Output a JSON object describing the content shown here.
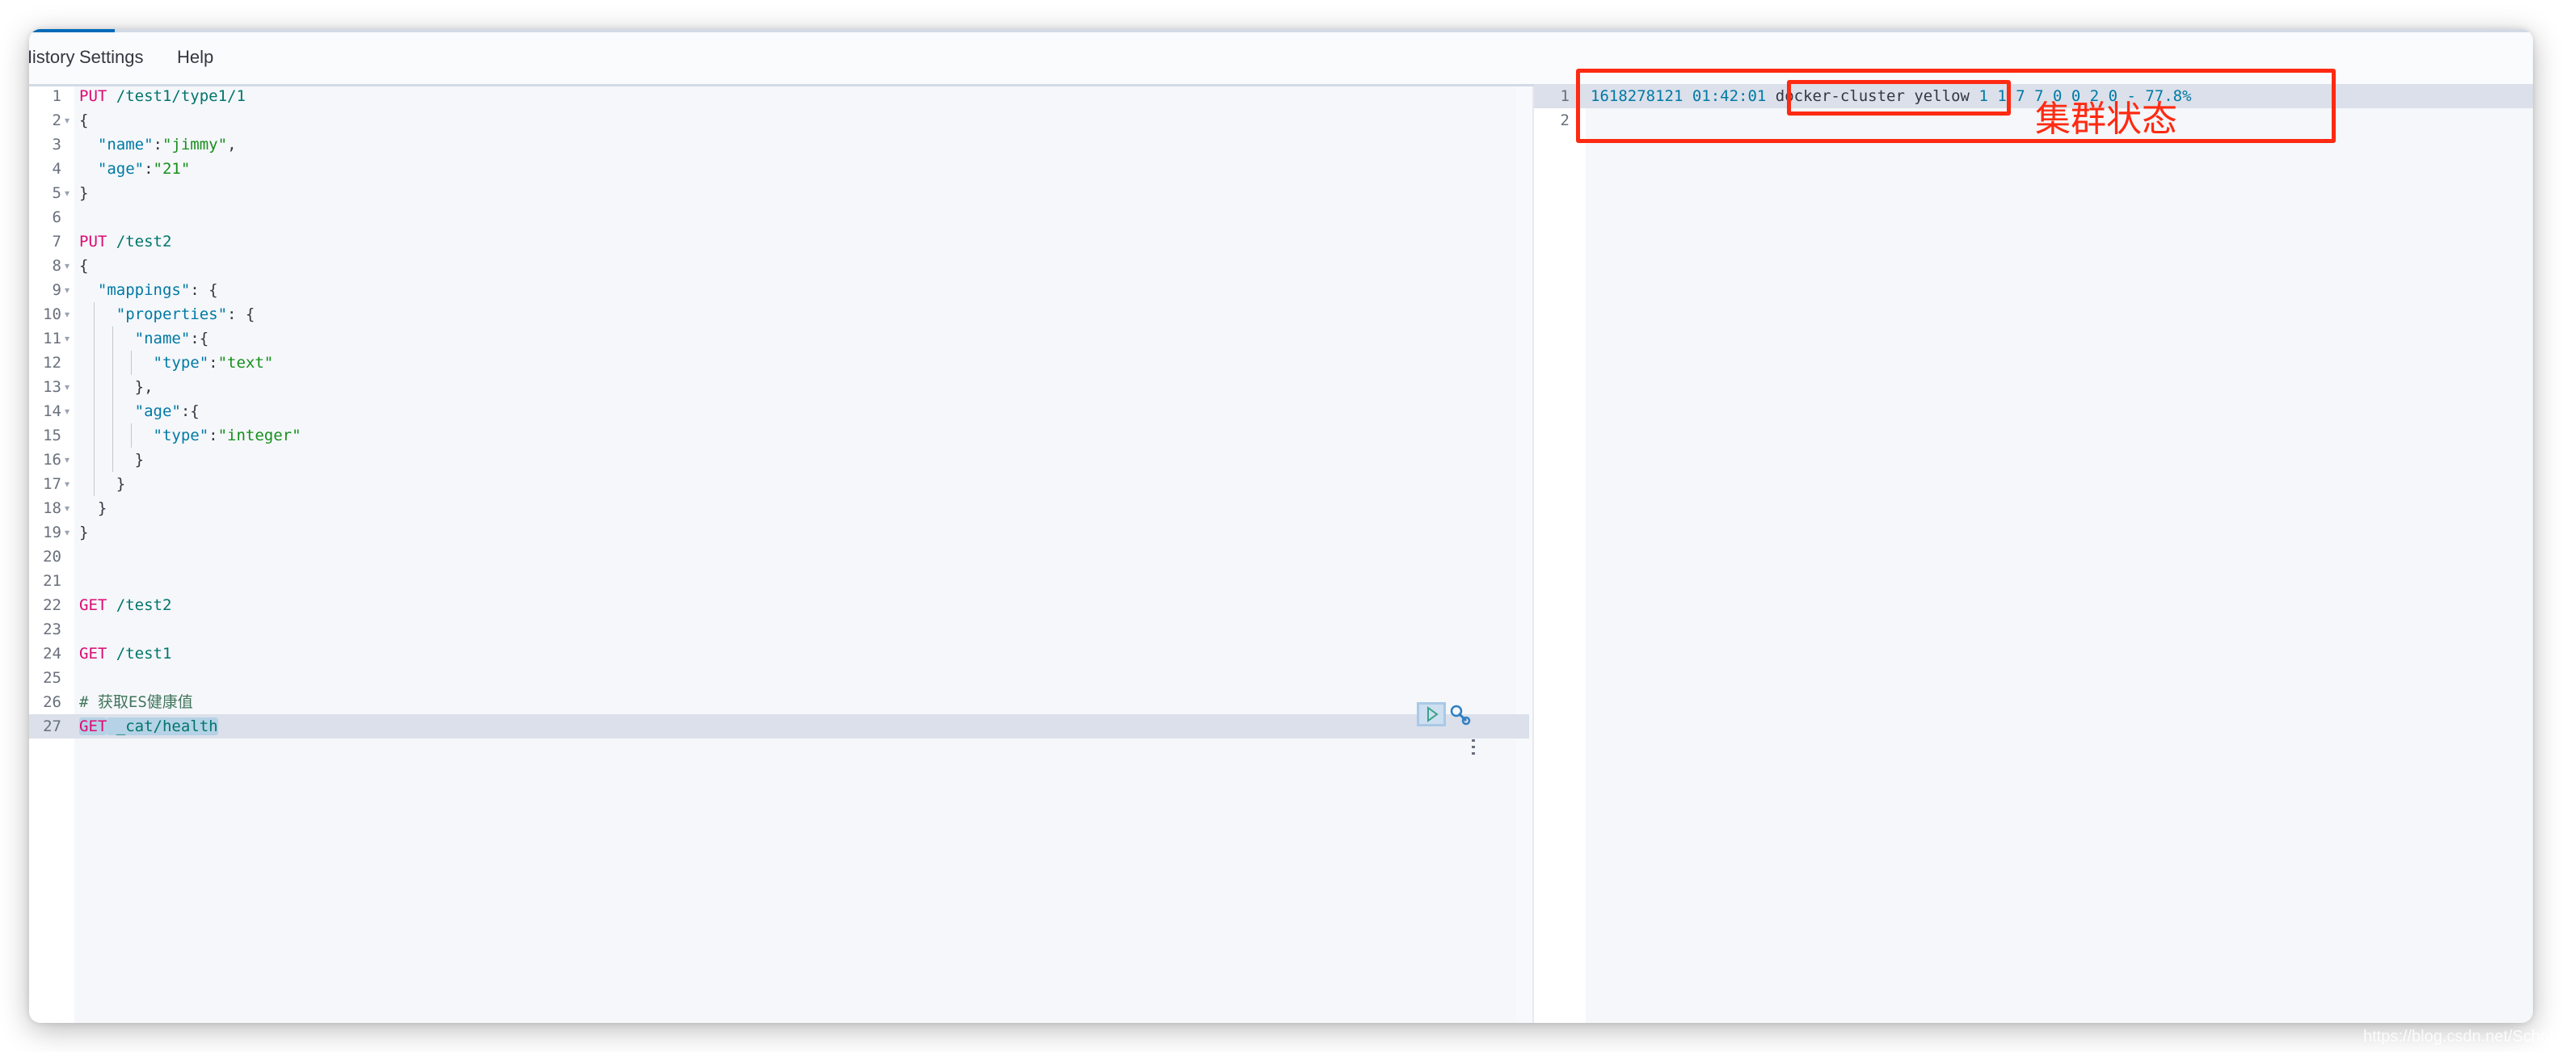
{
  "menu": {
    "items": [
      "History",
      "Settings",
      "Help"
    ]
  },
  "request_editor": {
    "lines": [
      {
        "n": "1",
        "fold": false,
        "tokens": [
          {
            "t": "PUT",
            "c": "m"
          },
          {
            "t": " /test1/type1/1",
            "c": "u"
          }
        ]
      },
      {
        "n": "2",
        "fold": true,
        "tokens": [
          {
            "t": "{",
            "c": "p"
          }
        ]
      },
      {
        "n": "3",
        "fold": false,
        "tokens": [
          {
            "t": "  ",
            "c": "p"
          },
          {
            "t": "\"name\"",
            "c": "k"
          },
          {
            "t": ":",
            "c": "p"
          },
          {
            "t": "\"jimmy\"",
            "c": "s"
          },
          {
            "t": ",",
            "c": "p"
          }
        ]
      },
      {
        "n": "4",
        "fold": false,
        "tokens": [
          {
            "t": "  ",
            "c": "p"
          },
          {
            "t": "\"age\"",
            "c": "k"
          },
          {
            "t": ":",
            "c": "p"
          },
          {
            "t": "\"21\"",
            "c": "s"
          }
        ]
      },
      {
        "n": "5",
        "fold": true,
        "tokens": [
          {
            "t": "}",
            "c": "p"
          }
        ]
      },
      {
        "n": "6",
        "fold": false,
        "tokens": []
      },
      {
        "n": "7",
        "fold": false,
        "tokens": [
          {
            "t": "PUT",
            "c": "m"
          },
          {
            "t": " /test2",
            "c": "u"
          }
        ]
      },
      {
        "n": "8",
        "fold": true,
        "tokens": [
          {
            "t": "{",
            "c": "p"
          }
        ]
      },
      {
        "n": "9",
        "fold": true,
        "tokens": [
          {
            "t": "  ",
            "c": "p"
          },
          {
            "t": "\"mappings\"",
            "c": "k"
          },
          {
            "t": ": {",
            "c": "p"
          }
        ]
      },
      {
        "n": "10",
        "fold": true,
        "guides": 1,
        "tokens": [
          {
            "t": "    ",
            "c": "p"
          },
          {
            "t": "\"properties\"",
            "c": "k"
          },
          {
            "t": ": {",
            "c": "p"
          }
        ]
      },
      {
        "n": "11",
        "fold": true,
        "guides": 2,
        "tokens": [
          {
            "t": "      ",
            "c": "p"
          },
          {
            "t": "\"name\"",
            "c": "k"
          },
          {
            "t": ":{",
            "c": "p"
          }
        ]
      },
      {
        "n": "12",
        "fold": false,
        "guides": 3,
        "tokens": [
          {
            "t": "        ",
            "c": "p"
          },
          {
            "t": "\"type\"",
            "c": "k"
          },
          {
            "t": ":",
            "c": "p"
          },
          {
            "t": "\"text\"",
            "c": "s"
          }
        ]
      },
      {
        "n": "13",
        "fold": true,
        "guides": 2,
        "tokens": [
          {
            "t": "      },",
            "c": "p"
          }
        ]
      },
      {
        "n": "14",
        "fold": true,
        "guides": 2,
        "tokens": [
          {
            "t": "      ",
            "c": "p"
          },
          {
            "t": "\"age\"",
            "c": "k"
          },
          {
            "t": ":{",
            "c": "p"
          }
        ]
      },
      {
        "n": "15",
        "fold": false,
        "guides": 3,
        "tokens": [
          {
            "t": "        ",
            "c": "p"
          },
          {
            "t": "\"type\"",
            "c": "k"
          },
          {
            "t": ":",
            "c": "p"
          },
          {
            "t": "\"integer\"",
            "c": "s"
          }
        ]
      },
      {
        "n": "16",
        "fold": true,
        "guides": 2,
        "tokens": [
          {
            "t": "      }",
            "c": "p"
          }
        ]
      },
      {
        "n": "17",
        "fold": true,
        "guides": 1,
        "tokens": [
          {
            "t": "    }",
            "c": "p"
          }
        ]
      },
      {
        "n": "18",
        "fold": true,
        "tokens": [
          {
            "t": "  }",
            "c": "p"
          }
        ]
      },
      {
        "n": "19",
        "fold": true,
        "tokens": [
          {
            "t": "}",
            "c": "p"
          }
        ]
      },
      {
        "n": "20",
        "fold": false,
        "tokens": []
      },
      {
        "n": "21",
        "fold": false,
        "tokens": []
      },
      {
        "n": "22",
        "fold": false,
        "tokens": [
          {
            "t": "GET",
            "c": "m"
          },
          {
            "t": " /test2",
            "c": "u"
          }
        ]
      },
      {
        "n": "23",
        "fold": false,
        "tokens": []
      },
      {
        "n": "24",
        "fold": false,
        "tokens": [
          {
            "t": "GET",
            "c": "m"
          },
          {
            "t": " /test1",
            "c": "u"
          }
        ]
      },
      {
        "n": "25",
        "fold": false,
        "tokens": []
      },
      {
        "n": "26",
        "fold": false,
        "tokens": [
          {
            "t": "# 获取ES健康值",
            "c": "c"
          }
        ]
      },
      {
        "n": "27",
        "fold": false,
        "active": true,
        "tokens": [
          {
            "t": "GET",
            "c": "m",
            "sel": true
          },
          {
            "t": " _cat/health",
            "c": "u",
            "sel": true
          }
        ]
      }
    ],
    "actions": {
      "run_icon": "play-icon",
      "settings_icon": "wrench-icon"
    }
  },
  "response_editor": {
    "lines": [
      {
        "n": "1",
        "active": true,
        "tokens": [
          {
            "t": "1618278121 01:42:01 ",
            "c": "n"
          },
          {
            "t": "docker-cluster yellow",
            "c": "p"
          },
          {
            "t": " 1 1 7 7 0 0 2 0 - 77.8%",
            "c": "n"
          }
        ]
      },
      {
        "n": "2",
        "tokens": []
      }
    ]
  },
  "annotation": {
    "label": "集群状态",
    "color": "#ff2a12"
  },
  "watermark": "https://blog.csdn.net/ScholarTan"
}
